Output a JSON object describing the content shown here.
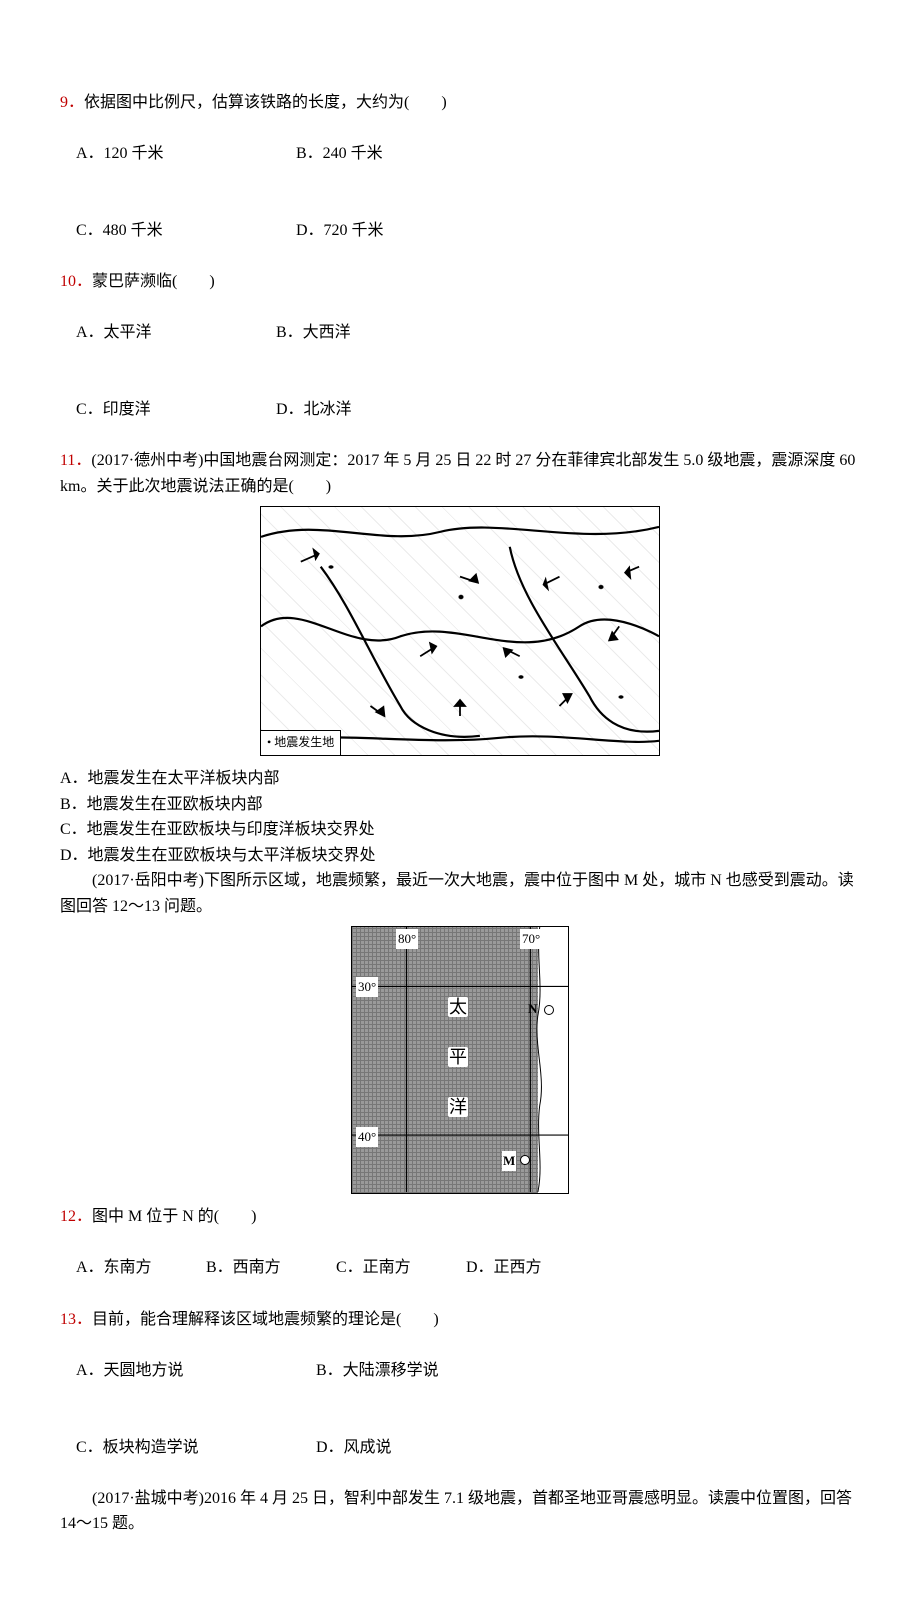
{
  "q9": {
    "num": "9．",
    "stem": "依据图中比例尺，估算该铁路的长度，大约为(　　)",
    "optA": "A．120 千米",
    "optB": "B．240 千米",
    "optC": "C．480 千米",
    "optD": "D．720 千米"
  },
  "q10": {
    "num": "10．",
    "stem": "蒙巴萨濒临(　　)",
    "optA": "A．太平洋",
    "optB": "B．大西洋",
    "optC": "C．印度洋",
    "optD": "D．北冰洋"
  },
  "q11": {
    "num": "11．",
    "stem": "(2017·德州中考)中国地震台网测定：2017 年 5 月 25 日 22 时 27 分在菲律宾北部发生 5.0 级地震，震源深度 60 km。关于此次地震说法正确的是(　　)",
    "legend": "地震发生地",
    "optA": "A．地震发生在太平洋板块内部",
    "optB": "B．地震发生在亚欧板块内部",
    "optC": "C．地震发生在亚欧板块与印度洋板块交界处",
    "optD": "D．地震发生在亚欧板块与太平洋板块交界处"
  },
  "intro12_13": "(2017·岳阳中考)下图所示区域，地震频繁，最近一次大地震，震中位于图中 M 处，城市 N 也感受到震动。读图回答 12～13 问题。",
  "map2": {
    "lon80": "80°",
    "lon70": "70°",
    "lat30": "30°",
    "lat40": "40°",
    "c1": "太",
    "c2": "平",
    "c3": "洋",
    "N": "N",
    "M": "M"
  },
  "q12": {
    "num": "12．",
    "stem": "图中 M 位于 N 的(　　)",
    "optA": "A．东南方",
    "optB": "B．西南方",
    "optC": "C．正南方",
    "optD": "D．正西方"
  },
  "q13": {
    "num": "13．",
    "stem": "目前，能合理解释该区域地震频繁的理论是(　　)",
    "optA": "A．天圆地方说",
    "optB": "B．大陆漂移学说",
    "optC": "C．板块构造学说",
    "optD": "D．风成说"
  },
  "intro14_15": "(2017·盐城中考)2016 年 4 月 25 日，智利中部发生 7.1 级地震，首都圣地亚哥震感明显。读震中位置图，回答 14～15 题。"
}
